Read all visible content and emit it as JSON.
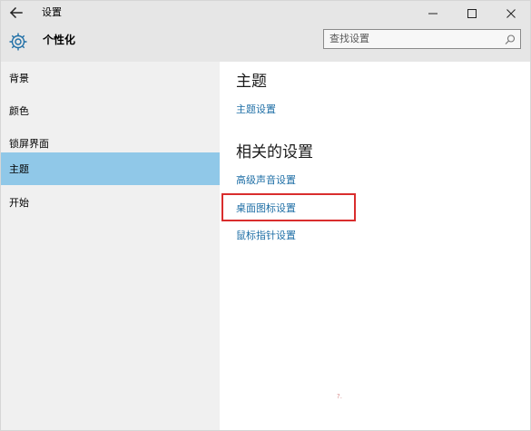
{
  "window": {
    "title": "设置",
    "back_icon": "arrow-left-icon",
    "controls": {
      "minimize_icon": "minimize-icon",
      "maximize_icon": "maximize-icon",
      "close_icon": "close-icon"
    }
  },
  "header": {
    "title": "个性化",
    "icon": "gear-icon"
  },
  "search": {
    "placeholder": "查找设置",
    "icon": "search-icon"
  },
  "sidebar": {
    "items": [
      {
        "label": "背景",
        "selected": false
      },
      {
        "label": "颜色",
        "selected": false
      },
      {
        "label": "锁屏界面",
        "selected": false
      },
      {
        "label": "主题",
        "selected": true
      },
      {
        "label": "开始",
        "selected": false
      }
    ]
  },
  "main": {
    "theme_section": {
      "heading": "主题",
      "links": [
        "主题设置"
      ]
    },
    "related_section": {
      "heading": "相关的设置",
      "links": [
        "高级声音设置",
        "桌面图标设置",
        "鼠标指针设置"
      ]
    },
    "annotation_mark": "?."
  },
  "colors": {
    "accent": "#1f6fa6",
    "selection": "#90c8e8",
    "highlight_border": "#d92d2d",
    "titlebar": "#e6e6e6",
    "sidebar": "#f0f0f0"
  }
}
